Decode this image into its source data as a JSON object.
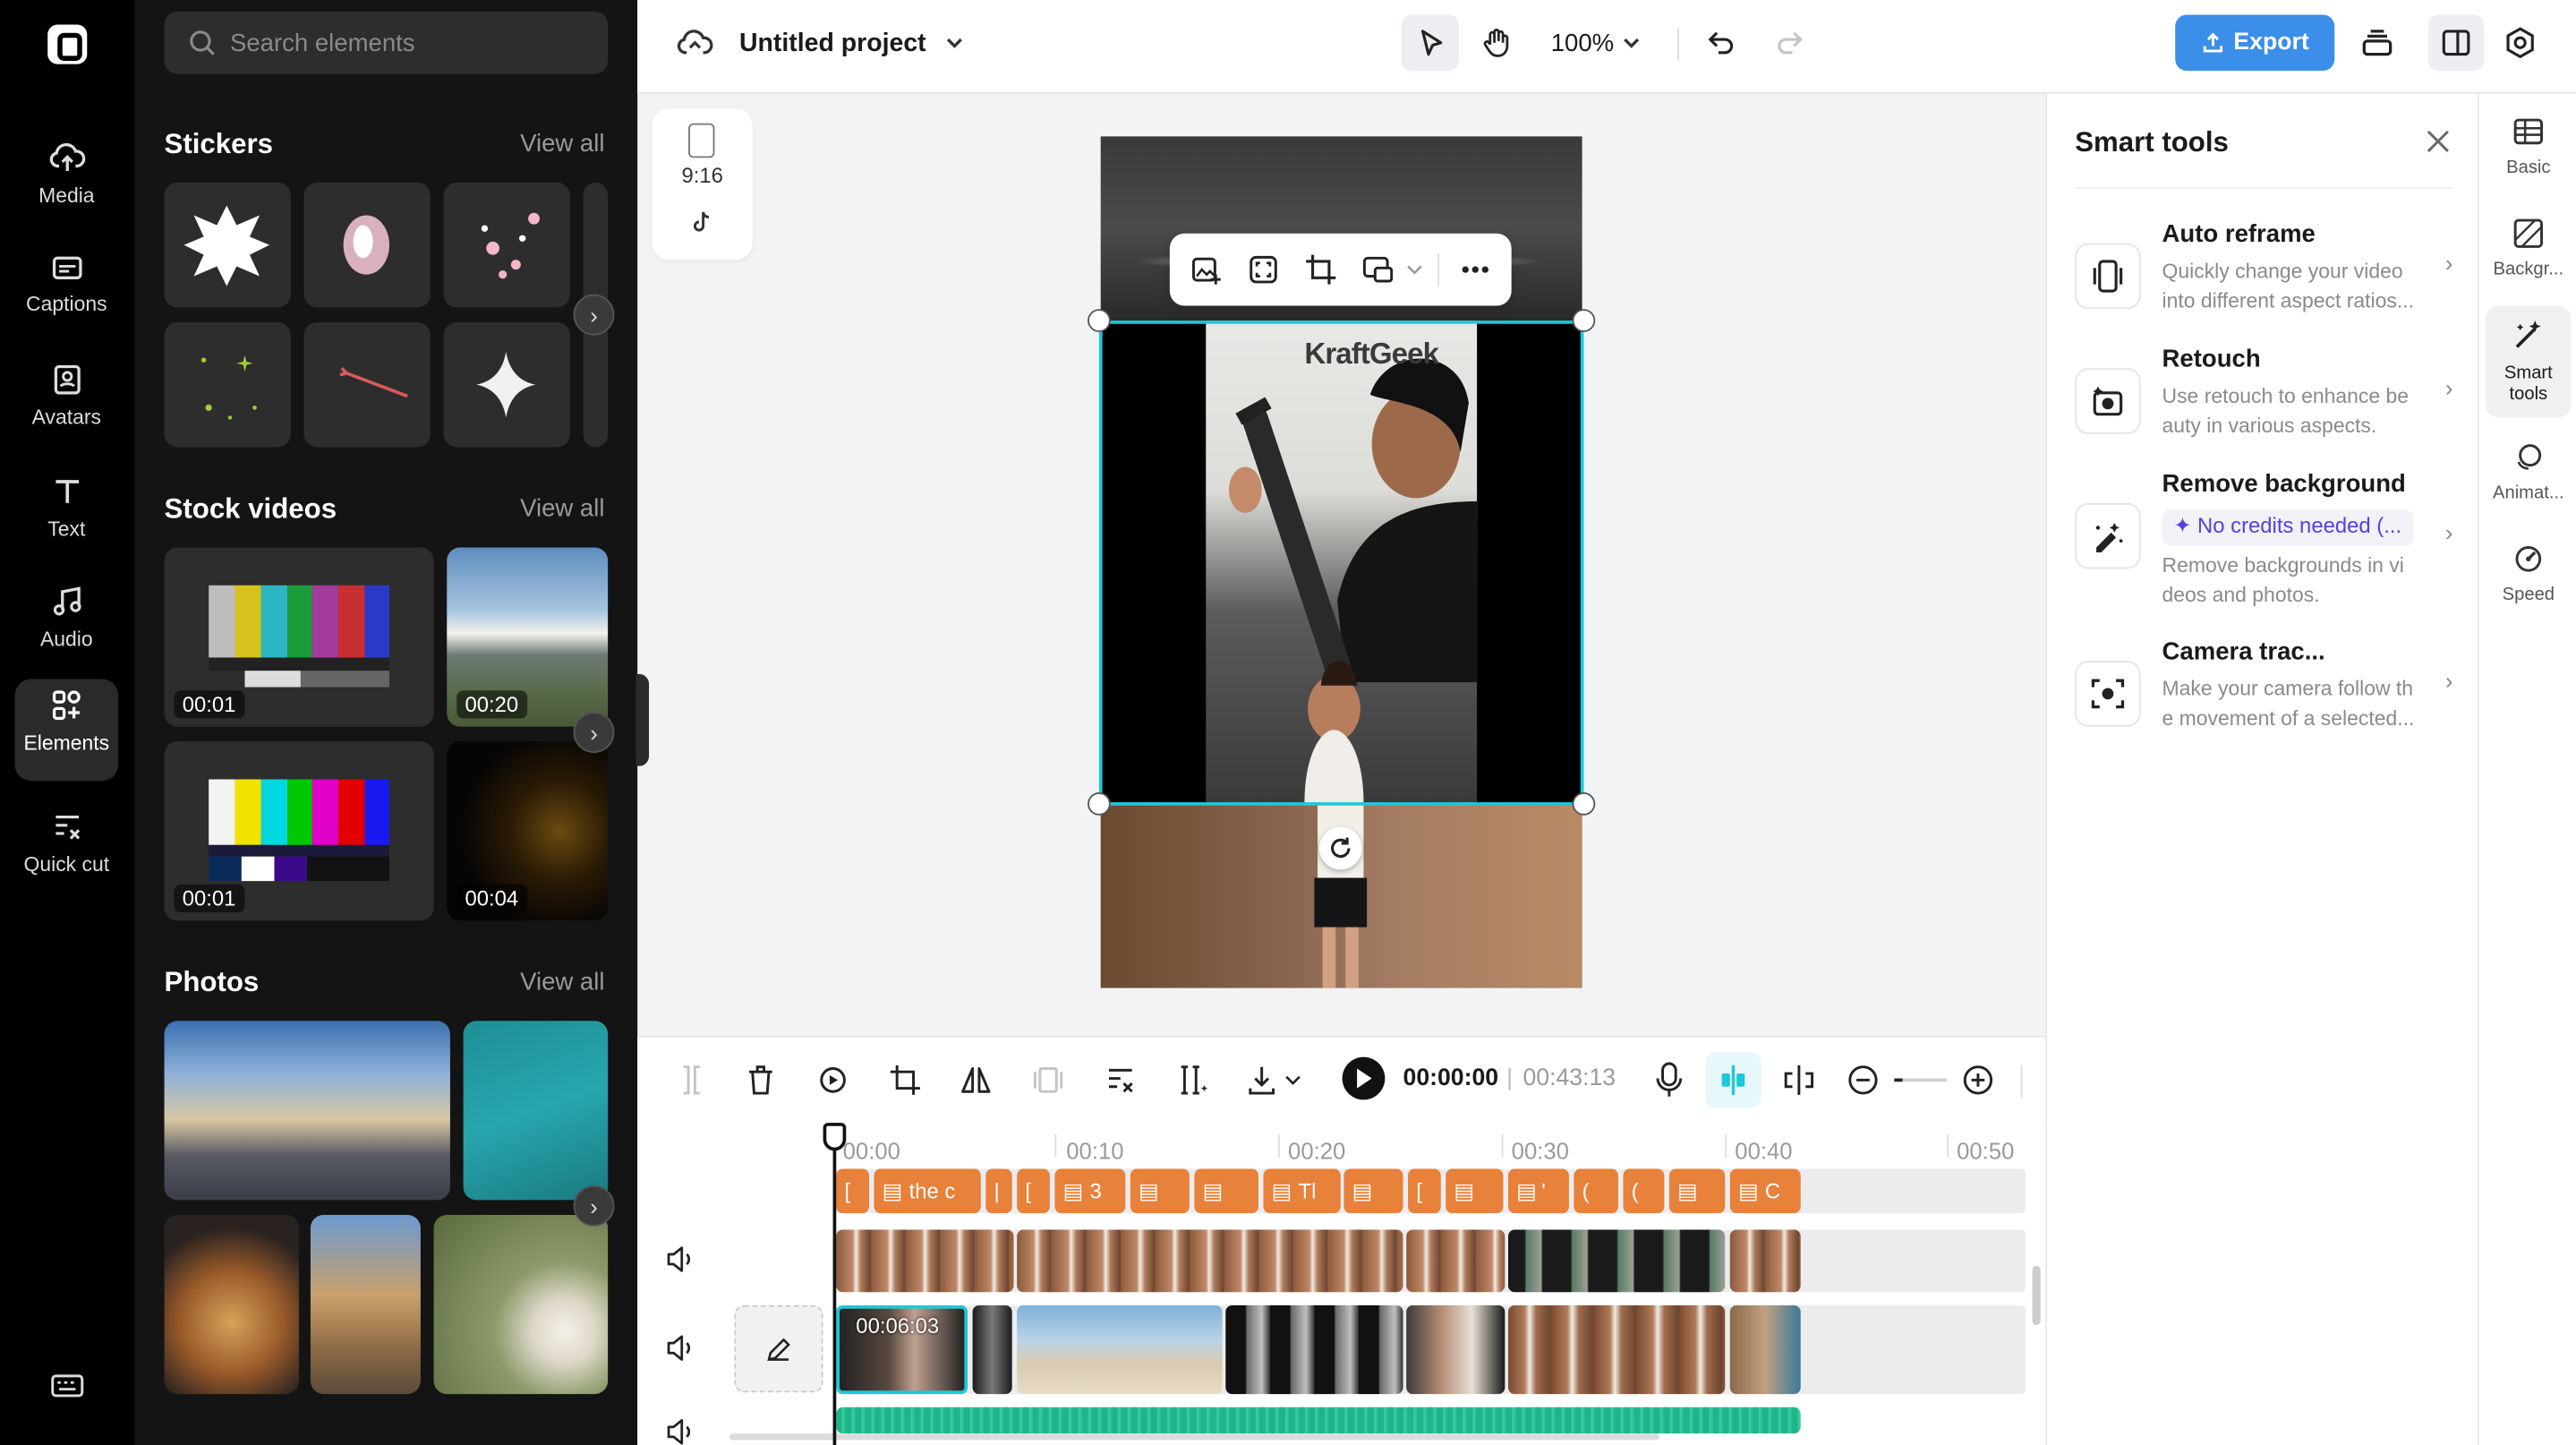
{
  "rail": {
    "items": [
      {
        "label": "Media",
        "icon": "cloud-upload-icon"
      },
      {
        "label": "Captions",
        "icon": "captions-icon"
      },
      {
        "label": "Avatars",
        "icon": "avatar-icon"
      },
      {
        "label": "Text",
        "icon": "text-icon"
      },
      {
        "label": "Audio",
        "icon": "music-icon"
      },
      {
        "label": "Elements",
        "icon": "elements-icon",
        "active": true
      },
      {
        "label": "Quick cut",
        "icon": "quick-cut-icon"
      }
    ]
  },
  "panel": {
    "search_placeholder": "Search elements",
    "stickers": {
      "title": "Stickers",
      "view_all": "View all"
    },
    "stock_videos": {
      "title": "Stock videos",
      "view_all": "View all",
      "durations": [
        "00:01",
        "00:20",
        "00:01",
        "00:04"
      ]
    },
    "photos": {
      "title": "Photos",
      "view_all": "View all"
    }
  },
  "topbar": {
    "project_title": "Untitled project",
    "zoom": "100%",
    "export_label": "Export"
  },
  "canvas": {
    "ratio_label": "9:16",
    "watermark": "KraftGeek"
  },
  "smart_tools": {
    "title": "Smart tools",
    "items": [
      {
        "name": "Auto reframe",
        "desc": "Quickly change your video into different aspect ratios..."
      },
      {
        "name": "Retouch",
        "desc": "Use retouch to enhance be auty in various aspects."
      },
      {
        "name": "Remove background",
        "badge": "No credits needed (...",
        "desc": "Remove backgrounds in vi deos and photos."
      },
      {
        "name": "Camera trac...",
        "desc": "Make your camera follow th e movement of a selected..."
      }
    ]
  },
  "right_tabs": [
    {
      "label": "Basic"
    },
    {
      "label": "Backgr..."
    },
    {
      "label": "Smart tools",
      "active": true
    },
    {
      "label": "Animat..."
    },
    {
      "label": "Speed"
    }
  ],
  "timeline": {
    "current_time": "00:00:00",
    "total_time": "00:43:13",
    "ruler": [
      "00:00",
      "00:10",
      "00:20",
      "00:30",
      "00:40",
      "00:50"
    ],
    "caption_clips": [
      "[",
      "the c",
      "|",
      "[",
      "3",
      "",
      "",
      "Tl",
      "",
      "[",
      "",
      "'",
      "(",
      "(",
      "",
      "C"
    ],
    "selected_clip_time": "00:06:03"
  },
  "colors": {
    "accent": "#3b8fe8",
    "caption_clip": "#e8813a",
    "audio_track": "#1fb58a",
    "selection": "#1ec8d8"
  }
}
